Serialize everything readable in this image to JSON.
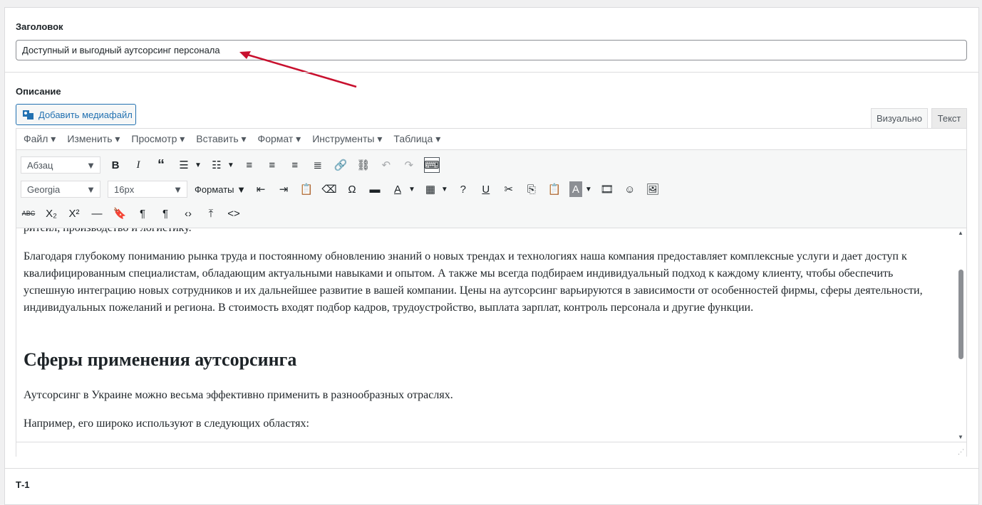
{
  "title_field": {
    "label": "Заголовок",
    "value": "Доступный и выгодный аутсорсинг персонала"
  },
  "description": {
    "label": "Описание",
    "add_media": "Добавить медиафайл",
    "tabs": [
      "Визуально",
      "Текст"
    ]
  },
  "menubar": [
    "Файл ▾",
    "Изменить ▾",
    "Просмотр ▾",
    "Вставить ▾",
    "Формат ▾",
    "Инструменты ▾",
    "Таблица ▾"
  ],
  "toolbar": {
    "block_format": "Абзац",
    "font_family": "Georgia",
    "font_size": "16px",
    "formats": "Форматы"
  },
  "content": {
    "cut_line": "ритейл, производство и логистику.",
    "para1": "Благодаря глубокому пониманию рынка труда и постоянному обновлению знаний о новых трендах и технологиях наша компания предоставляет комплексные услуги и дает доступ к квалифицированным специалистам, обладающим актуальными навыками и опытом. А также мы всегда подбираем индивидуальный подход к каждому клиенту, чтобы обеспечить успешную интеграцию новых сотрудников и их дальнейшее развитие в вашей компании. Цены на аутсорсинг варьируются в зависимости от особенностей фирмы, сферы деятельности, индивидуальных пожеланий и региона. В стоимость входят подбор кадров, трудоустройство, выплата зарплат, контроль персонала и другие функции.",
    "heading": "Сферы применения аутсорсинга",
    "para2": "Аутсорсинг в Украине можно весьма эффективно применить в разнообразных отраслях.",
    "para3": "Например, его широко используют в следующих областях:"
  },
  "next_section_label": "Т-1",
  "colors": {
    "accent": "#2271b1",
    "arrow": "#c8102e"
  }
}
